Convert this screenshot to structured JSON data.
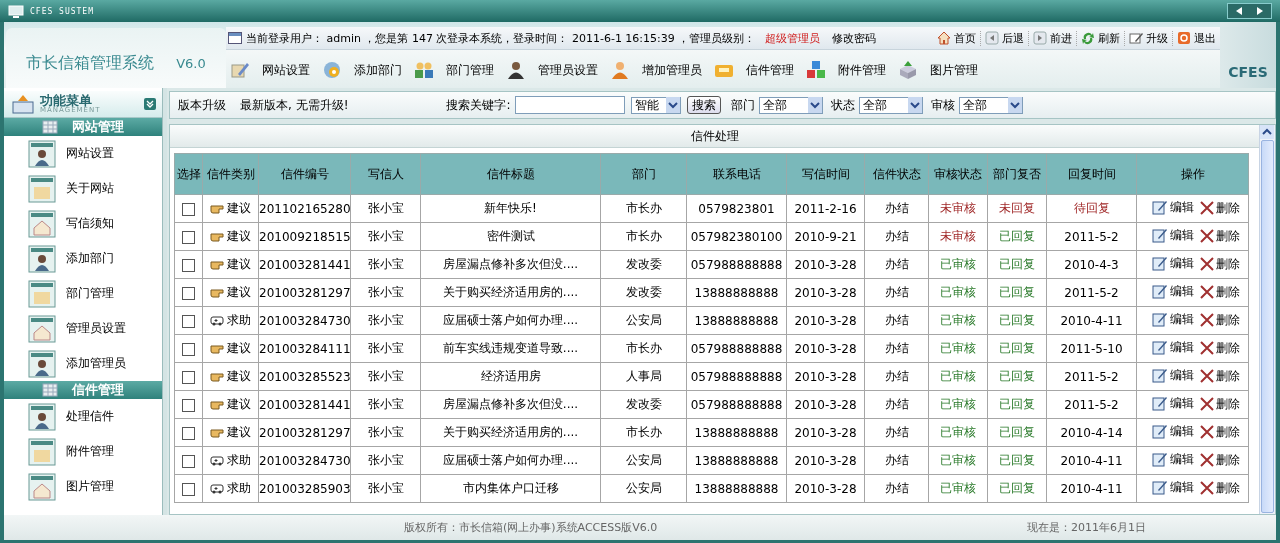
{
  "window": {
    "title": "CFES SUSTEM"
  },
  "header": {
    "app_name": "市长信箱管理系统",
    "version": "V6.0",
    "brand": "CFES",
    "login_info": "当前登录用户： admin ，您是第 147 次登录本系统，登录时间： 2011-6-1 16:15:39 ，管理员级别：",
    "admin_level": "超级管理员",
    "change_password": "修改密码",
    "nav_links": [
      {
        "label": "首页",
        "kind": "home"
      },
      {
        "label": "后退",
        "kind": "back"
      },
      {
        "label": "前进",
        "kind": "forward"
      },
      {
        "label": "刷新",
        "kind": "refresh"
      },
      {
        "label": "升级",
        "kind": "upgrade"
      },
      {
        "label": "退出",
        "kind": "exit"
      }
    ],
    "toolbar": [
      {
        "label": "网站设置",
        "kind": "settings"
      },
      {
        "label": "添加部门",
        "kind": "disc"
      },
      {
        "label": "部门管理",
        "kind": "group"
      },
      {
        "label": "管理员设置",
        "kind": "person"
      },
      {
        "label": "增加管理员",
        "kind": "person2"
      },
      {
        "label": "信件管理",
        "kind": "box"
      },
      {
        "label": "附件管理",
        "kind": "cubes"
      },
      {
        "label": "图片管理",
        "kind": "tray"
      }
    ]
  },
  "sidebar": {
    "title": "功能菜单",
    "subtitle": "MANAGEMENT",
    "groups": [
      {
        "title": "网站管理",
        "items": [
          {
            "label": "网站设置"
          },
          {
            "label": "关于网站"
          },
          {
            "label": "写信须知"
          },
          {
            "label": "添加部门"
          },
          {
            "label": "部门管理"
          },
          {
            "label": "管理员设置"
          },
          {
            "label": "添加管理员"
          }
        ]
      },
      {
        "title": "信件管理",
        "items": [
          {
            "label": "处理信件"
          },
          {
            "label": "附件管理"
          },
          {
            "label": "图片管理"
          }
        ]
      }
    ]
  },
  "search_bar": {
    "upgrade_label": "版本升级",
    "upgrade_message": "最新版本, 无需升级!",
    "keyword_label": "搜索关键字:",
    "mode": "智能",
    "search_button": "搜索",
    "filters": [
      {
        "label": "部门",
        "value": "全部"
      },
      {
        "label": "状态",
        "value": "全部"
      },
      {
        "label": "审核",
        "value": "全部"
      }
    ]
  },
  "table": {
    "title": "信件处理",
    "columns": [
      "选择",
      "信件类别",
      "信件编号",
      "写信人",
      "信件标题",
      "部门",
      "联系电话",
      "写信时间",
      "信件状态",
      "审核状态",
      "部门复否",
      "回复时间",
      "操作"
    ],
    "rows": [
      {
        "checked": false,
        "kind": "suggest",
        "category": "建议",
        "number": "201102165280",
        "writer": "张小宝",
        "subject": "新年快乐!",
        "department": "市长办",
        "phone": "0579823801",
        "date": "2011-2-16",
        "status": "办结",
        "audit": "未审核",
        "audited": false,
        "reply": "未回复",
        "replied": false,
        "reply_time": "待回复",
        "reply_pending": true,
        "edit": "编辑",
        "delete": "删除"
      },
      {
        "checked": false,
        "kind": "suggest",
        "category": "建议",
        "number": "201009218515",
        "writer": "张小宝",
        "subject": "密件测试",
        "department": "市长办",
        "phone": "057982380100",
        "date": "2010-9-21",
        "status": "办结",
        "audit": "未审核",
        "audited": false,
        "reply": "已回复",
        "replied": true,
        "reply_time": "2011-5-2",
        "reply_pending": false,
        "edit": "编辑",
        "delete": "删除"
      },
      {
        "checked": false,
        "kind": "suggest",
        "category": "建议",
        "number": "201003281441",
        "writer": "张小宝",
        "subject": "房屋漏点修补多次但没....",
        "department": "发改委",
        "phone": "057988888888",
        "date": "2010-3-28",
        "status": "办结",
        "audit": "已审核",
        "audited": true,
        "reply": "已回复",
        "replied": true,
        "reply_time": "2010-4-3",
        "reply_pending": false,
        "edit": "编辑",
        "delete": "删除"
      },
      {
        "checked": false,
        "kind": "suggest",
        "category": "建议",
        "number": "201003281297",
        "writer": "张小宝",
        "subject": "关于购买经济适用房的....",
        "department": "发改委",
        "phone": "13888888888",
        "date": "2010-3-28",
        "status": "办结",
        "audit": "已审核",
        "audited": true,
        "reply": "已回复",
        "replied": true,
        "reply_time": "2011-5-2",
        "reply_pending": false,
        "edit": "编辑",
        "delete": "删除"
      },
      {
        "checked": false,
        "kind": "help",
        "category": "求助",
        "number": "201003284730",
        "writer": "张小宝",
        "subject": "应届硕士落户如何办理....",
        "department": "公安局",
        "phone": "13888888888",
        "date": "2010-3-28",
        "status": "办结",
        "audit": "已审核",
        "audited": true,
        "reply": "已回复",
        "replied": true,
        "reply_time": "2010-4-11",
        "reply_pending": false,
        "edit": "编辑",
        "delete": "删除"
      },
      {
        "checked": false,
        "kind": "suggest",
        "category": "建议",
        "number": "201003284111",
        "writer": "张小宝",
        "subject": "前车实线违规变道导致....",
        "department": "市长办",
        "phone": "057988888888",
        "date": "2010-3-28",
        "status": "办结",
        "audit": "已审核",
        "audited": true,
        "reply": "已回复",
        "replied": true,
        "reply_time": "2011-5-10",
        "reply_pending": false,
        "edit": "编辑",
        "delete": "删除"
      },
      {
        "checked": false,
        "kind": "suggest",
        "category": "建议",
        "number": "201003285523",
        "writer": "张小宝",
        "subject": "经济适用房",
        "department": "人事局",
        "phone": "057988888888",
        "date": "2010-3-28",
        "status": "办结",
        "audit": "已审核",
        "audited": true,
        "reply": "已回复",
        "replied": true,
        "reply_time": "2011-5-2",
        "reply_pending": false,
        "edit": "编辑",
        "delete": "删除"
      },
      {
        "checked": false,
        "kind": "suggest",
        "category": "建议",
        "number": "201003281441",
        "writer": "张小宝",
        "subject": "房屋漏点修补多次但没....",
        "department": "发改委",
        "phone": "057988888888",
        "date": "2010-3-28",
        "status": "办结",
        "audit": "已审核",
        "audited": true,
        "reply": "已回复",
        "replied": true,
        "reply_time": "2011-5-2",
        "reply_pending": false,
        "edit": "编辑",
        "delete": "删除"
      },
      {
        "checked": false,
        "kind": "suggest",
        "category": "建议",
        "number": "201003281297",
        "writer": "张小宝",
        "subject": "关于购买经济适用房的....",
        "department": "市长办",
        "phone": "13888888888",
        "date": "2010-3-28",
        "status": "办结",
        "audit": "已审核",
        "audited": true,
        "reply": "已回复",
        "replied": true,
        "reply_time": "2010-4-14",
        "reply_pending": false,
        "edit": "编辑",
        "delete": "删除"
      },
      {
        "checked": false,
        "kind": "help",
        "category": "求助",
        "number": "201003284730",
        "writer": "张小宝",
        "subject": "应届硕士落户如何办理....",
        "department": "公安局",
        "phone": "13888888888",
        "date": "2010-3-28",
        "status": "办结",
        "audit": "已审核",
        "audited": true,
        "reply": "已回复",
        "replied": true,
        "reply_time": "2010-4-11",
        "reply_pending": false,
        "edit": "编辑",
        "delete": "删除"
      },
      {
        "checked": false,
        "kind": "help",
        "category": "求助",
        "number": "201003285903",
        "writer": "张小宝",
        "subject": "市内集体户口迁移",
        "department": "公安局",
        "phone": "13888888888",
        "date": "2010-3-28",
        "status": "办结",
        "audit": "已审核",
        "audited": true,
        "reply": "已回复",
        "replied": true,
        "reply_time": "2010-4-11",
        "reply_pending": false,
        "edit": "编辑",
        "delete": "删除"
      }
    ]
  },
  "status_bar": {
    "copyright": "版权所有：市长信箱(网上办事)系统ACCESS版V6.0",
    "now": "现在是：2011年6月1日"
  }
}
